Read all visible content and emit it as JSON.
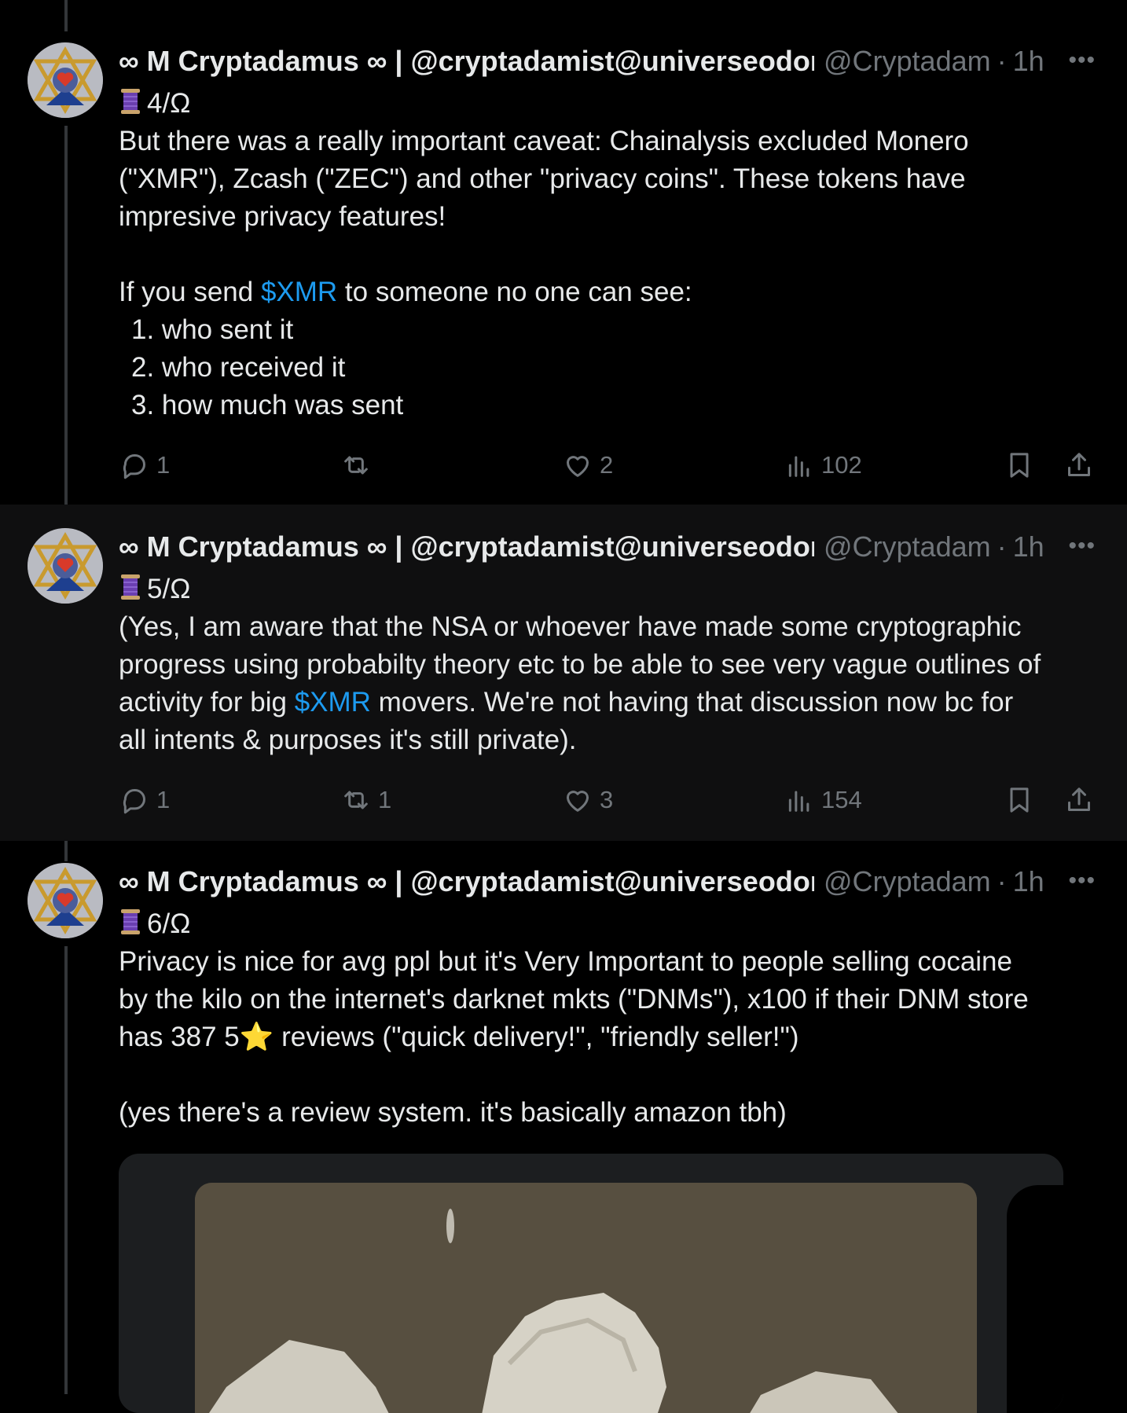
{
  "thread": [
    {
      "author": {
        "name": "∞ M Cryptadamus ∞ | @cryptadamist@universeodon.com",
        "handle": "@Cryptadam",
        "time": "1h"
      },
      "counter": "4/Ω",
      "body": {
        "line1": "But there was a really important caveat: Chainalysis excluded Monero",
        "line2": "(\"XMR\"), Zcash (\"ZEC\") and other \"privacy coins\". These tokens have",
        "line3": "impresive privacy features!",
        "send_pre": "If you send ",
        "cashtag": "$XMR",
        "send_post": " to someone no one can see:",
        "list": [
          "1. who sent it",
          "2. who received it",
          "3. how much was sent"
        ]
      },
      "stats": {
        "replies": "1",
        "reposts": "",
        "likes": "2",
        "views": "102"
      }
    },
    {
      "author": {
        "name": "∞ M Cryptadamus ∞ | @cryptadamist@universeodon.com",
        "handle": "@Cryptadam",
        "time": "1h"
      },
      "counter": "5/Ω",
      "body": {
        "line1": "(Yes, I am aware that the NSA or whoever have made some cryptographic",
        "line2": "progress using probabilty theory etc to be able to see very vague outlines of",
        "line3_pre": "activity for big ",
        "cashtag": "$XMR",
        "line3_post": " movers. We're not having that discussion now bc for",
        "line4": "all intents & purposes it's still private)."
      },
      "stats": {
        "replies": "1",
        "reposts": "1",
        "likes": "3",
        "views": "154"
      }
    },
    {
      "author": {
        "name": "∞ M Cryptadamus ∞ | @cryptadamist@universeodon.com",
        "handle": "@Cryptadam",
        "time": "1h"
      },
      "counter": "6/Ω",
      "body": {
        "line1": "Privacy is nice for avg ppl but it's Very Important to people selling cocaine",
        "line2": "by the kilo on the internet's darknet mkts (\"DNMs\"), x100 if their DNM store",
        "line3_pre": "has 387 5",
        "star": "⭐",
        "line3_post": " reviews (\"quick delivery!\", \"friendly seller!\")",
        "line4": "(yes there's a review system. it's basically amazon tbh)"
      }
    }
  ],
  "icons": {
    "more": "more-dots-icon",
    "reply": "reply-icon",
    "repost": "repost-icon",
    "like": "heart-icon",
    "views": "views-icon",
    "bookmark": "bookmark-icon",
    "share": "share-icon",
    "thread_marker": "spool-of-thread-emoji"
  },
  "colors": {
    "background": "#000000",
    "highlight_background": "#0f0f10",
    "text": "#e7e9ea",
    "muted": "#71767b",
    "cashtag": "#1d9bf0"
  }
}
